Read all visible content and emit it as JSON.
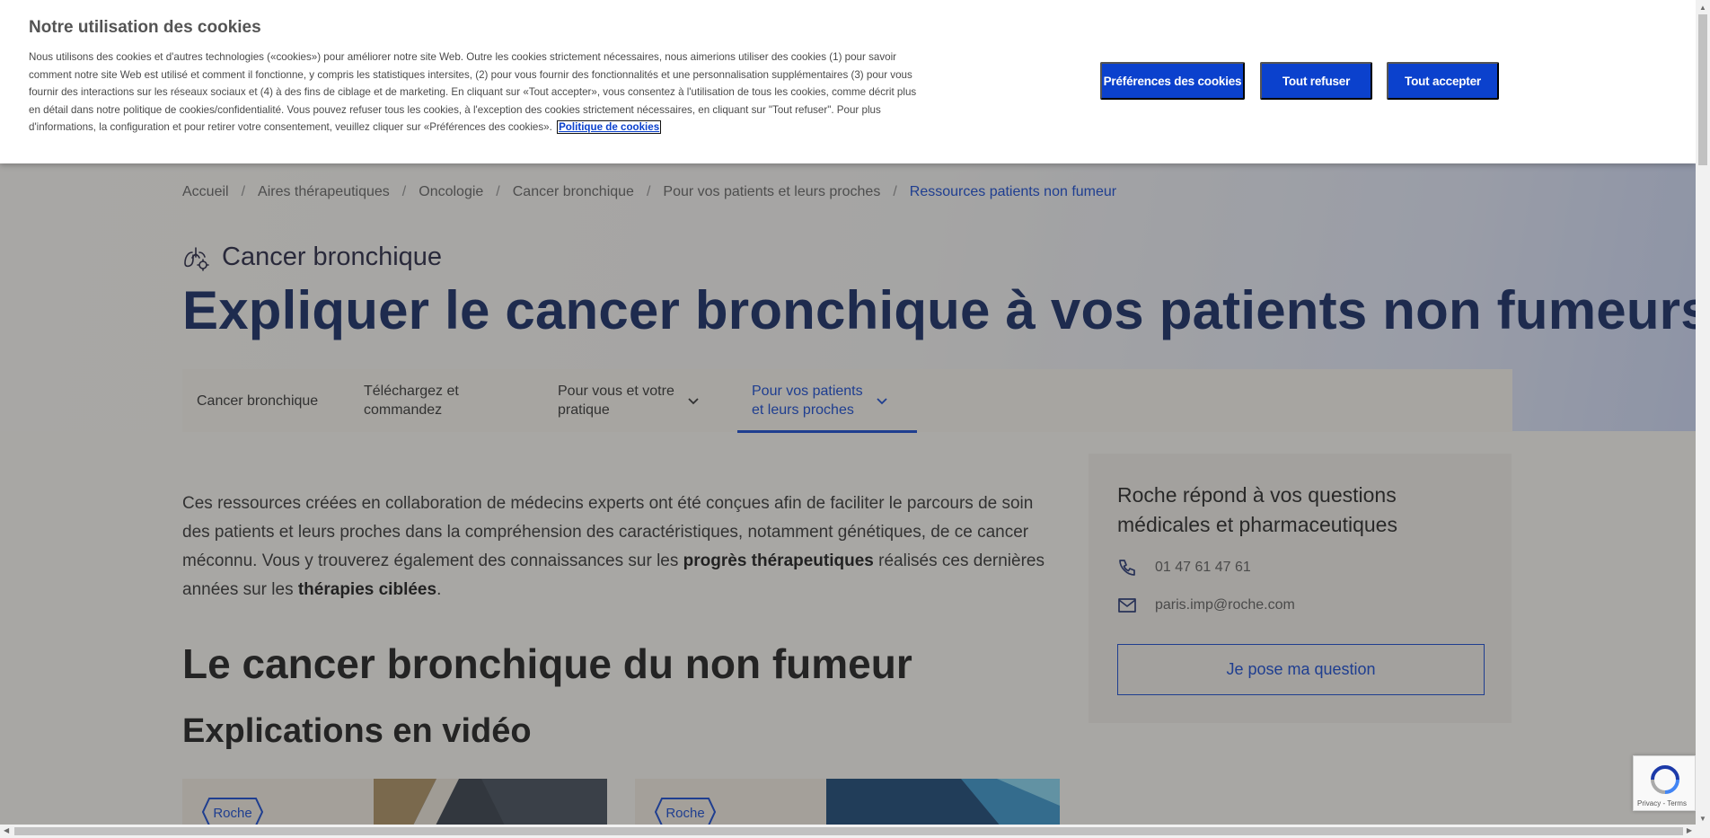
{
  "cookie_banner": {
    "title": "Notre utilisation des cookies",
    "body": "Nous utilisons des cookies et d'autres technologies («cookies») pour améliorer notre site Web. Outre les cookies strictement nécessaires, nous aimerions utiliser des cookies (1) pour savoir comment notre site Web est utilisé et comment il fonctionne, y compris les statistiques intersites, (2) pour vous fournir des fonctionnalités et une personnalisation supplémentaires (3) pour vous fournir des interactions sur les réseaux sociaux et (4) à des fins de ciblage et de marketing. En cliquant sur «Tout accepter», vous consentez à l'utilisation de tous les cookies, comme décrit plus en détail dans notre politique de cookies/confidentialité. Vous pouvez refuser tous les cookies, à l'exception des cookies strictement nécessaires, en cliquant sur \"Tout refuser\". Pour plus d'informations, la configuration et pour retirer votre consentement, veuillez cliquer sur «Préférences des cookies».",
    "policy_link": "Politique de cookies",
    "buttons": {
      "preferences": "Préférences des cookies",
      "reject_all": "Tout refuser",
      "accept_all": "Tout accepter"
    }
  },
  "breadcrumb": {
    "items": [
      "Accueil",
      "Aires thérapeutiques",
      "Oncologie",
      "Cancer bronchique",
      "Pour vos patients et leurs proches",
      "Ressources patients non fumeur"
    ],
    "separator": "/"
  },
  "hero": {
    "eyebrow": "Cancer bronchique",
    "eyebrow_icon": "lungs-icon",
    "title": "Expliquer le cancer bronchique à vos patients non fumeurs"
  },
  "subnav": {
    "items": [
      {
        "line1": "Cancer bronchique",
        "line2": ""
      },
      {
        "line1": "Téléchargez et",
        "line2": "commandez"
      },
      {
        "line1": "Pour vous et votre",
        "line2": "pratique"
      },
      {
        "line1": "Pour vos patients",
        "line2": "et leurs proches"
      }
    ],
    "active_index": 3
  },
  "intro": {
    "part1": "Ces ressources créées en collaboration de médecins experts ont été conçues afin de faciliter le parcours de soin des patients et leurs proches dans la compréhension des caractéristiques, notamment génétiques, de ce cancer méconnu. Vous y trouverez également des connaissances sur les ",
    "bold1": "progrès thérapeutiques",
    "part2": " réalisés ces dernières années sur les ",
    "bold2": "thérapies ciblées",
    "part3": "."
  },
  "section": {
    "heading": "Le cancer bronchique du non fumeur",
    "subheading": "Explications en vidéo"
  },
  "video_cards": [
    {
      "logo_text": "Roche"
    },
    {
      "logo_text": "Roche"
    }
  ],
  "contact": {
    "title": "Roche répond à vos questions médicales et pharmaceutiques",
    "phone": "01 47 61 47 61",
    "email": "paris.imp@roche.com",
    "button": "Je pose ma question"
  },
  "recaptcha": {
    "text": "Privacy - Terms"
  },
  "colors": {
    "brand_blue": "#0b41cd",
    "headline_navy": "#0a1f5c",
    "overlay": "rgba(60,60,60,0.42)"
  }
}
